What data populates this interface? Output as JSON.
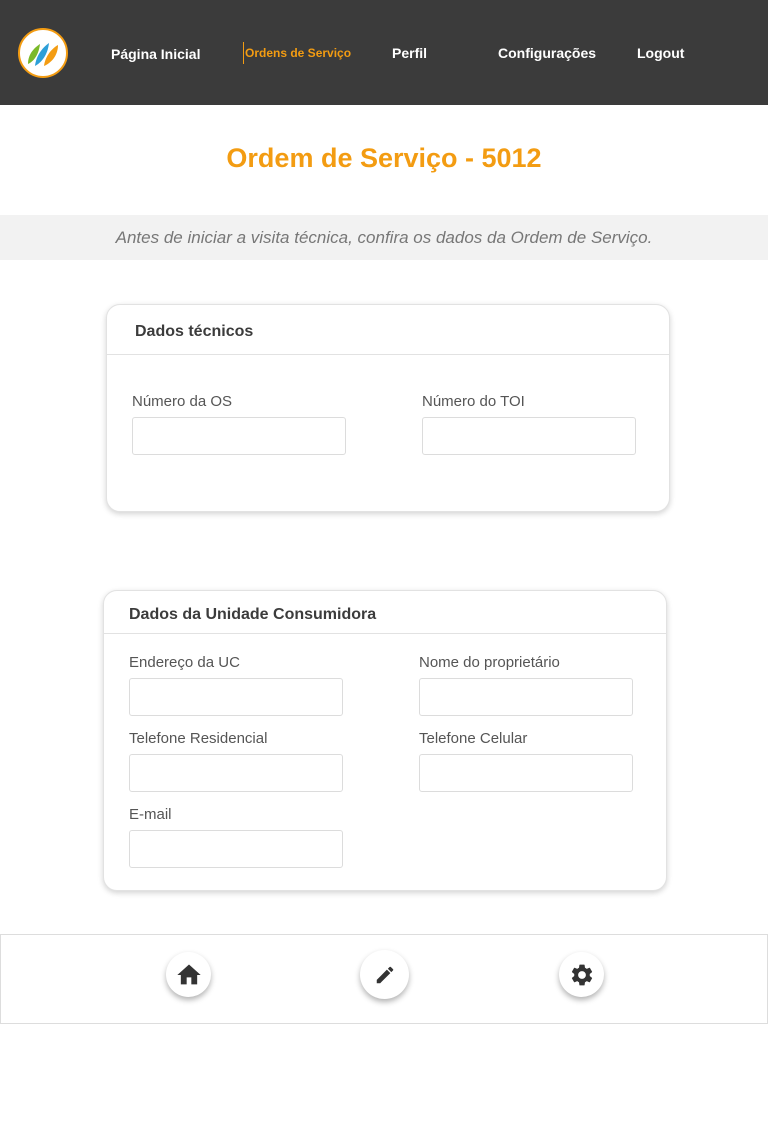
{
  "nav": {
    "items": [
      {
        "label": "Página Inicial",
        "active": false
      },
      {
        "label": "Ordens de Serviço",
        "active": true
      },
      {
        "label": "Perfil",
        "active": false
      },
      {
        "label": "Configurações",
        "active": false
      },
      {
        "label": "Logout",
        "active": false
      }
    ]
  },
  "page": {
    "title": "Ordem de Serviço - 5012",
    "notice": "Antes de iniciar a visita técnica, confira os dados da Ordem de Serviço."
  },
  "technical_card": {
    "title": "Dados técnicos",
    "fields": [
      {
        "label": "Número da OS",
        "value": ""
      },
      {
        "label": "Número do TOI",
        "value": ""
      }
    ]
  },
  "consumer_card": {
    "title": "Dados da Unidade Consumidora",
    "fields": [
      {
        "label": "Endereço da UC",
        "value": ""
      },
      {
        "label": "Nome do proprietário",
        "value": ""
      },
      {
        "label": "Telefone Residencial",
        "value": ""
      },
      {
        "label": "Telefone Celular",
        "value": ""
      },
      {
        "label": "E-mail",
        "value": ""
      }
    ]
  },
  "bottom_nav": {
    "buttons": [
      {
        "icon": "home-icon"
      },
      {
        "icon": "pencil-icon"
      },
      {
        "icon": "gear-icon"
      }
    ]
  },
  "colors": {
    "accent": "#f39c12",
    "topbar": "#3b3b3b",
    "notice_bg": "#f2f2f2"
  }
}
